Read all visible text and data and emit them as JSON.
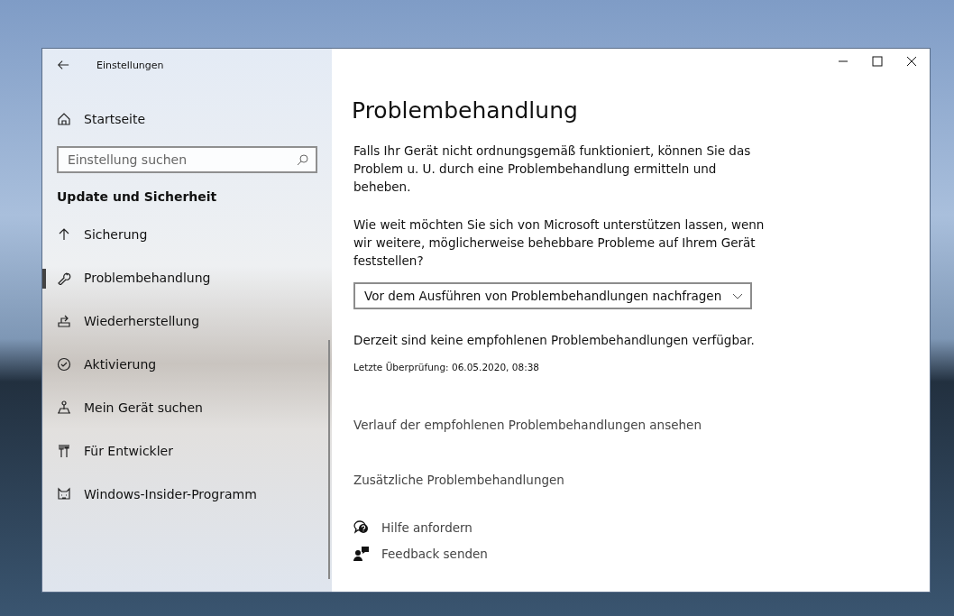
{
  "window": {
    "title": "Einstellungen"
  },
  "sidebar": {
    "home": "Startseite",
    "search": {
      "placeholder": "Einstellung suchen"
    },
    "section": "Update und Sicherheit",
    "items": [
      {
        "label": "Sicherung",
        "kind": "arrow",
        "selected": false
      },
      {
        "label": "Problembehandlung",
        "kind": "wrench",
        "selected": true
      },
      {
        "label": "Wiederherstellung",
        "kind": "restore",
        "selected": false
      },
      {
        "label": "Aktivierung",
        "kind": "check",
        "selected": false
      },
      {
        "label": "Mein Gerät suchen",
        "kind": "locate",
        "selected": false
      },
      {
        "label": "Für Entwickler",
        "kind": "tools",
        "selected": false
      },
      {
        "label": "Windows-Insider-Programm",
        "kind": "cat",
        "selected": false
      }
    ]
  },
  "content": {
    "title": "Problembehandlung",
    "intro": "Falls Ihr Gerät nicht ordnungsgemäß funktioniert, können Sie das Problem u. U. durch eine Problembehandlung ermitteln und beheben.",
    "question": "Wie weit möchten Sie sich von Microsoft unterstützen lassen, wenn wir weitere, möglicherweise behebbare Probleme auf Ihrem Gerät feststellen?",
    "dropdown": "Vor dem Ausführen von Problembehandlungen nachfragen",
    "status": "Derzeit sind keine empfohlenen Problembehandlungen verfügbar.",
    "last_check": "Letzte Überprüfung: 06.05.2020, 08:38",
    "links": [
      "Verlauf der empfohlenen Problembehandlungen ansehen",
      "Zusätzliche Problembehandlungen"
    ],
    "help": [
      {
        "label": "Hilfe anfordern",
        "kind": "help"
      },
      {
        "label": "Feedback senden",
        "kind": "feedback"
      }
    ]
  }
}
